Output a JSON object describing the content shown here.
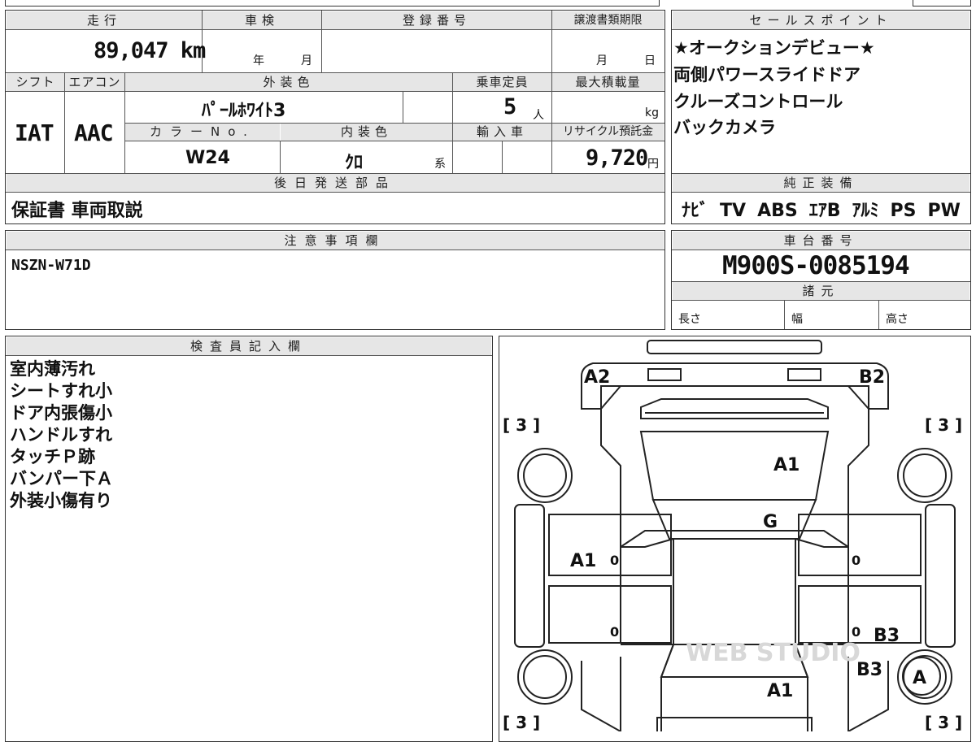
{
  "header": {
    "mileage_label": "走行",
    "mileage_value": "89,047 km",
    "inspection_label": "車検",
    "inspection_year": "年",
    "inspection_month": "月",
    "registration_label": "登録番号",
    "transfer_label": "譲渡書類期限",
    "transfer_month": "月",
    "transfer_day": "日"
  },
  "specs": {
    "shift_label": "シフト",
    "shift_value": "IAT",
    "ac_label": "エアコン",
    "ac_value": "AAC",
    "exterior_label": "外装色",
    "exterior_value": "ﾊﾟｰﾙﾎﾜｲﾄ3",
    "capacity_label": "乗車定員",
    "capacity_value": "5",
    "capacity_unit": "人",
    "maxload_label": "最大積載量",
    "maxload_unit": "kg",
    "colorno_label": "カラーNo.",
    "colorno_value": "W24",
    "interior_label": "内装色",
    "interior_value": "ｸﾛ",
    "interior_suffix": "系",
    "import_label": "輸入車",
    "recycle_label": "リサイクル預託金",
    "recycle_value": "9,720",
    "recycle_unit": "円"
  },
  "later_parts": {
    "label": "後日発送部品",
    "value": "保証書 車両取説"
  },
  "notes": {
    "label": "注意事項欄",
    "value": "NSZN-W71D"
  },
  "sales": {
    "label": "セールスポイント",
    "lines": [
      "★オークションデビュー★",
      "両側パワースライドドア",
      "クルーズコントロール",
      "バックカメラ"
    ]
  },
  "equipment": {
    "label": "純正装備",
    "items": [
      "ﾅﾋﾞ",
      "TV",
      "ABS",
      "ｴｱB",
      "ｱﾙﾐ",
      "PS",
      "PW"
    ]
  },
  "chassis": {
    "label": "車台番号",
    "value": "M900S-0085194"
  },
  "dimensions": {
    "label": "諸元",
    "length": "長さ",
    "width": "幅",
    "height": "高さ"
  },
  "inspector": {
    "label": "検査員記入欄",
    "lines": [
      "室内薄汚れ",
      "シートすれ小",
      "ドア内張傷小",
      "ハンドルすれ",
      "タッチＰ跡",
      "バンパー下Ａ",
      "外装小傷有り"
    ]
  },
  "diagram": {
    "front_left": "A2",
    "front_right": "B2",
    "hood": "A1",
    "windshield": "G",
    "left_door": "A1",
    "right_rear_door": "B3",
    "rear_quarter": "B3",
    "rear_wheel": "A",
    "rear": "A1",
    "door_zero_1": "0",
    "door_zero_2": "0",
    "door_zero_3": "0",
    "door_zero_4": "0",
    "tire_fl": "[ 3 ]",
    "tire_fr": "[ 3 ]",
    "tire_rl": "[ 3 ]",
    "tire_rr": "[ 3 ]",
    "watermark": "WEB STUDIO"
  }
}
